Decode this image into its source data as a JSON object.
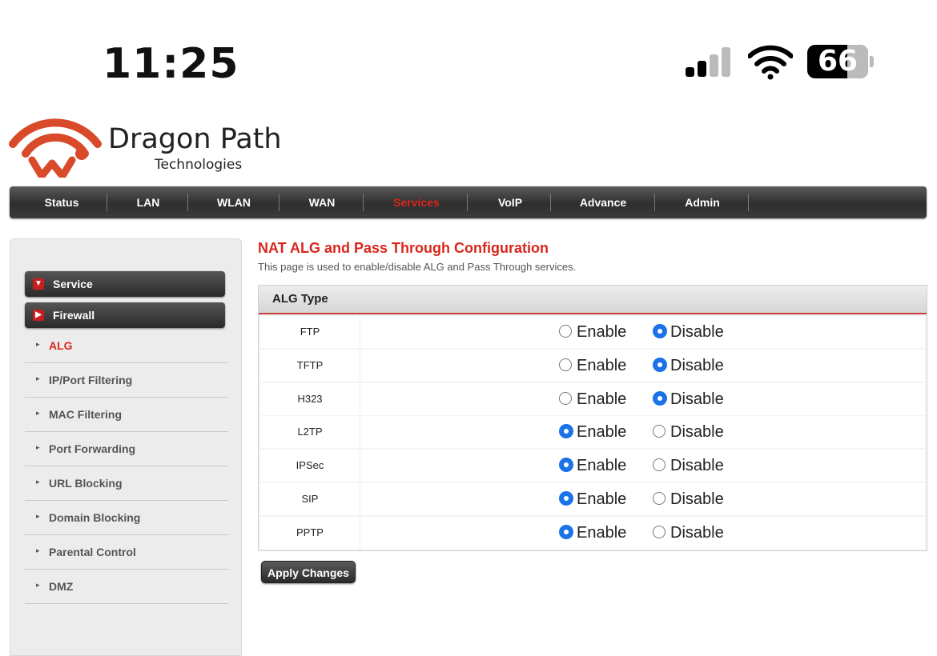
{
  "status_bar": {
    "time": "11:25",
    "battery": "66",
    "icons": [
      "cellular-signal-icon",
      "wifi-icon",
      "battery-icon"
    ]
  },
  "brand": {
    "name": "Dragon Path",
    "subtitle": "Technologies",
    "accent_color": "#d9261c"
  },
  "top_nav": {
    "items": [
      "Status",
      "LAN",
      "WLAN",
      "WAN",
      "Services",
      "VoIP",
      "Advance",
      "Admin"
    ],
    "active": "Services"
  },
  "sidebar": {
    "sections": [
      "Service",
      "Firewall"
    ],
    "items": [
      "ALG",
      "IP/Port Filtering",
      "MAC Filtering",
      "Port Forwarding",
      "URL Blocking",
      "Domain Blocking",
      "Parental Control",
      "DMZ"
    ],
    "active": "ALG"
  },
  "main": {
    "title": "NAT ALG and Pass Through Configuration",
    "description": "This page is used to enable/disable ALG and Pass Through services.",
    "table_header": "ALG Type",
    "enable_label": "Enable",
    "disable_label": "Disable",
    "rows": [
      {
        "name": "FTP",
        "value": "Disable"
      },
      {
        "name": "TFTP",
        "value": "Disable"
      },
      {
        "name": "H323",
        "value": "Disable"
      },
      {
        "name": "L2TP",
        "value": "Enable"
      },
      {
        "name": "IPSec",
        "value": "Enable"
      },
      {
        "name": "SIP",
        "value": "Enable"
      },
      {
        "name": "PPTP",
        "value": "Enable"
      }
    ],
    "apply_label": "Apply Changes"
  }
}
